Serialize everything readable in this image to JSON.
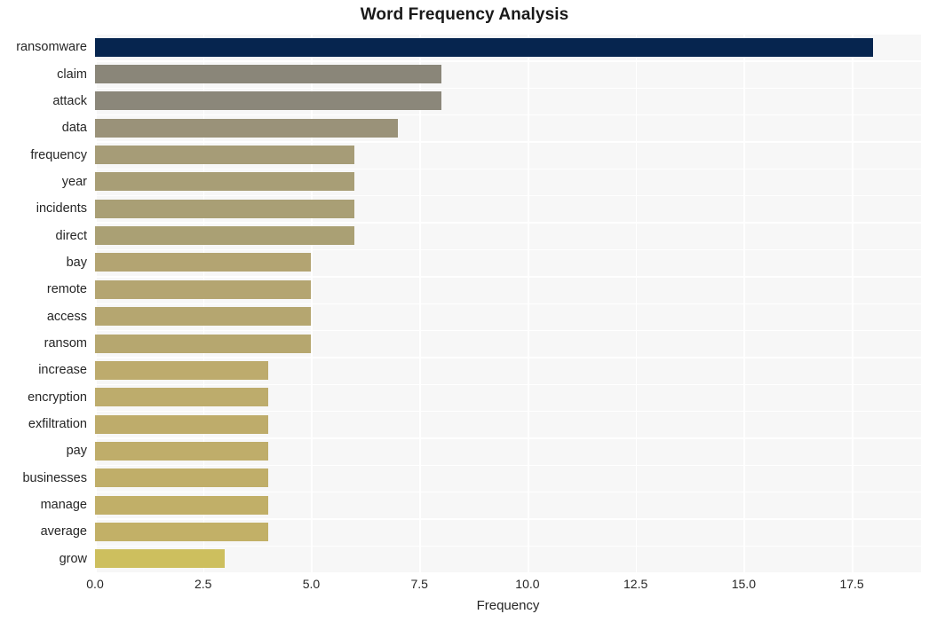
{
  "chart_data": {
    "type": "bar",
    "orientation": "horizontal",
    "title": "Word Frequency Analysis",
    "xlabel": "Frequency",
    "ylabel": "",
    "xlim": [
      0,
      19.1
    ],
    "ylim": [
      0,
      20
    ],
    "grid": true,
    "legend": null,
    "xticks": [
      "0.0",
      "2.5",
      "5.0",
      "7.5",
      "10.0",
      "12.5",
      "15.0",
      "17.5"
    ],
    "xtick_values": [
      0.0,
      2.5,
      5.0,
      7.5,
      10.0,
      12.5,
      15.0,
      17.5
    ],
    "categories": [
      "ransomware",
      "claim",
      "attack",
      "data",
      "frequency",
      "year",
      "incidents",
      "direct",
      "bay",
      "remote",
      "access",
      "ransom",
      "increase",
      "encryption",
      "exfiltration",
      "pay",
      "businesses",
      "manage",
      "average",
      "grow"
    ],
    "values": [
      18,
      8,
      8,
      7,
      6,
      6,
      6,
      6,
      5,
      5,
      5,
      5,
      4,
      4,
      4,
      4,
      4,
      4,
      4,
      3
    ],
    "bar_colors": [
      "#06254f",
      "#8a8679",
      "#8b877a",
      "#9a9279",
      "#a69c77",
      "#a89e76",
      "#a99f75",
      "#aaa074",
      "#b3a472",
      "#b4a571",
      "#b5a670",
      "#b6a76f",
      "#bdab6d",
      "#bdac6c",
      "#beac6b",
      "#bfad6a",
      "#c0ae69",
      "#c1af68",
      "#c2b067",
      "#cdbf5e"
    ],
    "background_color": "#f7f7f7",
    "gridline_color": "#ffffff",
    "text_color": "#262626"
  }
}
